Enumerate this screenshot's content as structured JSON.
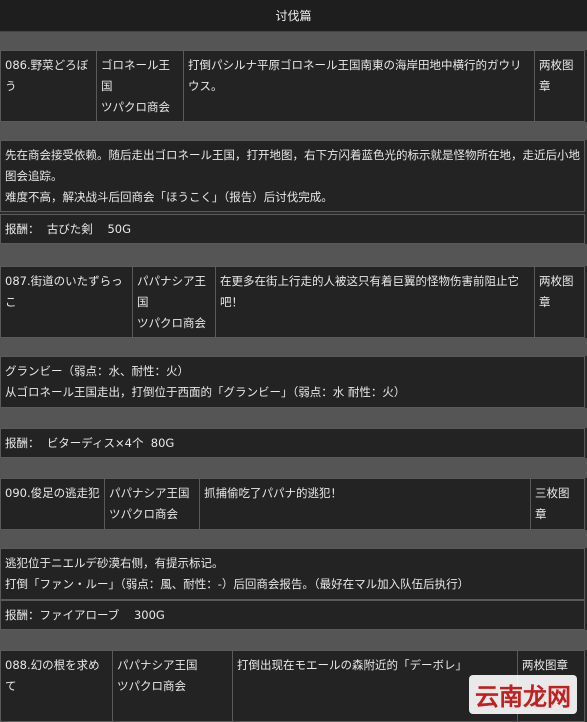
{
  "page_title": "讨伐篇",
  "quests": [
    {
      "name": "086.野菜どろぼう",
      "client_line1": "ゴロネール王国",
      "client_line2": "ツパクロ商会",
      "objective": "打倒パシルナ平原ゴロネール王国南東の海岸田地中横行的ガウリウス。",
      "reward_count": "两枚图章",
      "desc_lines": [
        "先在商会接受依赖。随后走出ゴロネール王国，打开地图，右下方闪着蓝色光的标示就是怪物所在地，走近后小地图会追踪。",
        "难度不高，解决战斗后回商会「ほうこく」（报告）后讨伐完成。"
      ],
      "reward_label": "报酬：",
      "reward_item": "古びた剣",
      "reward_gold": "50G"
    },
    {
      "name": "087.街道のいたずらっこ",
      "client_line1": "パパナシア王国",
      "client_line2": "ツパクロ商会",
      "objective": "在更多在街上行走的人被这只有着巨翼的怪物伤害前阻止它吧！",
      "reward_count": "两枚图章",
      "desc_lines": [
        "グランビー（弱点：水、耐性：火）",
        "从ゴロネール王国走出，打倒位于西面的「グランビー」（弱点：水 耐性：火）"
      ],
      "reward_label": "报酬：",
      "reward_item": "ビターディス×4个",
      "reward_gold": "80G"
    },
    {
      "name": "090.俊足の逃走犯",
      "client_line1": "パパナシア王国",
      "client_line2": "ツパクロ商会",
      "objective": "抓捕偷吃了パパナ的逃犯！",
      "reward_count": "三枚图章",
      "desc_lines": [
        "逃犯位于ニエルデ砂漠右侧，有提示标记。",
        "打倒「ファン・ルー」（弱点：風、耐性：-）后回商会报告。（最好在マル加入队伍后执行）"
      ],
      "reward_label": "报酬：",
      "reward_item": "ファイアローブ",
      "reward_gold": "300G"
    },
    {
      "name": "088.幻の根を求めて",
      "client_line1": "パパナシア王国",
      "client_line2": "ツパクロ商会",
      "objective": "打倒出现在モエールの森附近的「デーボレ」",
      "reward_count": "两枚图章"
    }
  ],
  "watermark": "云南龙网"
}
